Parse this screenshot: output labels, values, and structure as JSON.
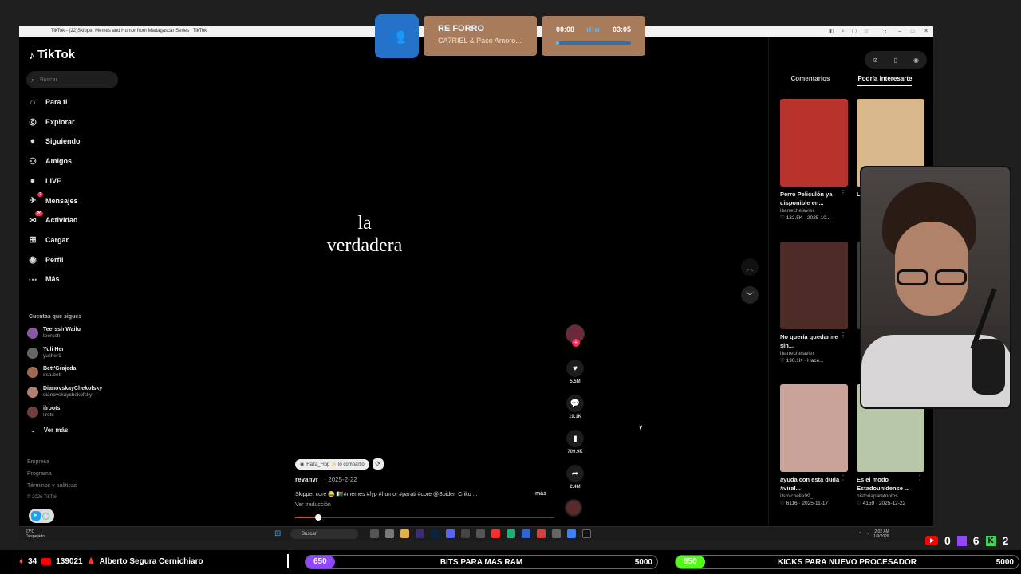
{
  "window": {
    "title": "TikTok - (22)Skipper Memes and Humor from Madagascar Series | TikTok"
  },
  "sidebar": {
    "logo": "TikTok",
    "search_placeholder": "Buscar",
    "nav": [
      {
        "label": "Para ti",
        "icon": "home-icon"
      },
      {
        "label": "Explorar",
        "icon": "compass-icon"
      },
      {
        "label": "Siguiendo",
        "icon": "following-icon"
      },
      {
        "label": "Amigos",
        "icon": "friends-icon"
      },
      {
        "label": "LIVE",
        "icon": "live-icon"
      },
      {
        "label": "Mensajes",
        "icon": "messages-icon",
        "badge": "2"
      },
      {
        "label": "Actividad",
        "icon": "activity-icon",
        "badge": "20"
      },
      {
        "label": "Cargar",
        "icon": "upload-icon"
      },
      {
        "label": "Perfil",
        "icon": "profile-icon"
      },
      {
        "label": "Más",
        "icon": "more-icon"
      }
    ],
    "following_title": "Cuentas que sigues",
    "following": [
      {
        "name": "Teerssh Waifu",
        "user": "teerssh"
      },
      {
        "name": "Yuli Her",
        "user": "yuliher1"
      },
      {
        "name": "Bett'Grajeda",
        "user": "esa.bett"
      },
      {
        "name": "DianovskayChekofsky",
        "user": "dianovskaychekofsky"
      },
      {
        "name": "ilroots",
        "user": "ilrots"
      }
    ],
    "see_more": "Ver más",
    "footer": [
      "Empresa",
      "Programa",
      "Términos y políticas"
    ],
    "copyright": "© 2026 TikTok"
  },
  "video": {
    "caption_line1": "la",
    "caption_line2": "verdadera",
    "repost_text": "Haza_Flop ✨ lo compartió",
    "author": "revanvr_",
    "date": "· 2025-2-22",
    "description": "Skipper core 😂 🇲🇬#memes #fyp #humor #parati #core @Spider_Criko ...",
    "more": "más",
    "translate": "Ver traducción",
    "progress": 0.09,
    "likes": "5.5M",
    "comments": "19.1K",
    "saves": "709.9K",
    "shares": "2.4M"
  },
  "right_panel": {
    "tab_comments": "Comentarios",
    "tab_interesting": "Podría interesarte",
    "cards": [
      {
        "title": "Perro Peliculón ya disponible en...",
        "user": "ibarrechejavier",
        "stats": "♡ 132.5K · 2025-10...",
        "color": "#b8332b"
      },
      {
        "title": "L...",
        "user": "",
        "stats": "",
        "color": "#d9b98c"
      },
      {
        "title": "No quería quedarme sin...",
        "user": "ibarrechejavier",
        "stats": "♡ 190.1K · Hace...",
        "color": "#4d2c27"
      },
      {
        "title": "",
        "user": "",
        "stats": "",
        "color": "#3a3a3a"
      },
      {
        "title": "ayuda con esta duda #viral...",
        "user": "itsmichelle99_",
        "stats": "♡ 6116 · 2025-11-17",
        "color": "#c9a39a"
      },
      {
        "title": "Es el modo Estadounidense ...",
        "user": "historiaparatontos",
        "stats": "♡ 4159 · 2025-12-22",
        "color": "#b8c7a8"
      }
    ]
  },
  "media_widget": {
    "song": "RE FORRO",
    "artist": "CA7RIEL & Paco Amoro...",
    "elapsed": "00:08",
    "duration": "03:05"
  },
  "taskbar": {
    "weather_temp": "27°C",
    "weather_desc": "Despejado",
    "search": "Buscar",
    "time": "2:02 AM",
    "date": "1/9/2026"
  },
  "stream": {
    "yt_count": "0",
    "twitch_count": "6",
    "kick_count": "2",
    "fire_count": "34",
    "yt_subs": "139021",
    "name": "Alberto Segura Cernichiaro",
    "goal1": {
      "value": "650",
      "label": "BITS PARA MAS RAM",
      "target": "5000",
      "color": "#9146ff"
    },
    "goal2": {
      "value": "950",
      "label": "KICKS PARA NUEVO PROCESADOR",
      "target": "5000",
      "color": "#53fc18"
    }
  }
}
